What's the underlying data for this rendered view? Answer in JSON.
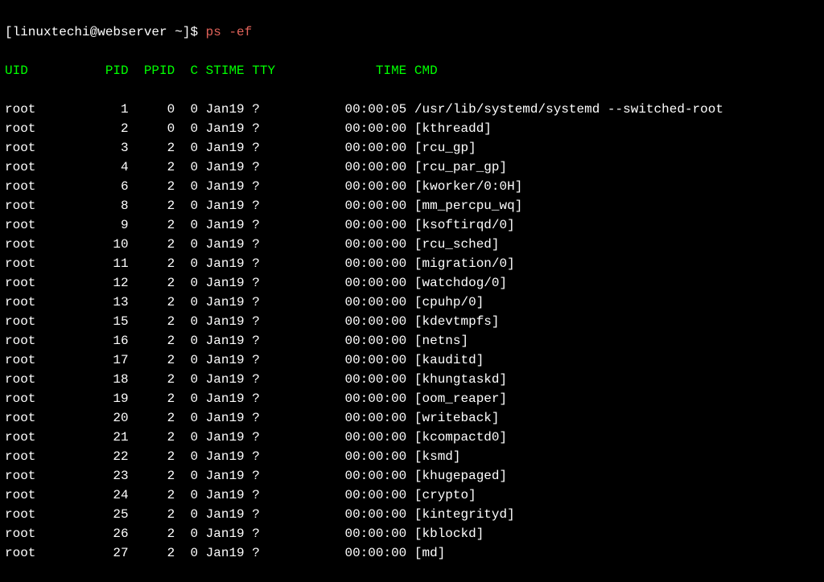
{
  "prompt": {
    "prefix": "[linuxtechi@webserver ~]$ ",
    "command": "ps",
    "args": " -ef"
  },
  "headers": {
    "uid": "UID",
    "pid": "PID",
    "ppid": "PPID",
    "c": "C",
    "stime": "STIME",
    "tty": "TTY",
    "time": "TIME",
    "cmd": "CMD"
  },
  "processes": [
    {
      "uid": "root",
      "pid": "1",
      "ppid": "0",
      "c": "0",
      "stime": "Jan19",
      "tty": "?",
      "time": "00:00:05",
      "cmd": "/usr/lib/systemd/systemd --switched-root"
    },
    {
      "uid": "root",
      "pid": "2",
      "ppid": "0",
      "c": "0",
      "stime": "Jan19",
      "tty": "?",
      "time": "00:00:00",
      "cmd": "[kthreadd]"
    },
    {
      "uid": "root",
      "pid": "3",
      "ppid": "2",
      "c": "0",
      "stime": "Jan19",
      "tty": "?",
      "time": "00:00:00",
      "cmd": "[rcu_gp]"
    },
    {
      "uid": "root",
      "pid": "4",
      "ppid": "2",
      "c": "0",
      "stime": "Jan19",
      "tty": "?",
      "time": "00:00:00",
      "cmd": "[rcu_par_gp]"
    },
    {
      "uid": "root",
      "pid": "6",
      "ppid": "2",
      "c": "0",
      "stime": "Jan19",
      "tty": "?",
      "time": "00:00:00",
      "cmd": "[kworker/0:0H]"
    },
    {
      "uid": "root",
      "pid": "8",
      "ppid": "2",
      "c": "0",
      "stime": "Jan19",
      "tty": "?",
      "time": "00:00:00",
      "cmd": "[mm_percpu_wq]"
    },
    {
      "uid": "root",
      "pid": "9",
      "ppid": "2",
      "c": "0",
      "stime": "Jan19",
      "tty": "?",
      "time": "00:00:00",
      "cmd": "[ksoftirqd/0]"
    },
    {
      "uid": "root",
      "pid": "10",
      "ppid": "2",
      "c": "0",
      "stime": "Jan19",
      "tty": "?",
      "time": "00:00:00",
      "cmd": "[rcu_sched]"
    },
    {
      "uid": "root",
      "pid": "11",
      "ppid": "2",
      "c": "0",
      "stime": "Jan19",
      "tty": "?",
      "time": "00:00:00",
      "cmd": "[migration/0]"
    },
    {
      "uid": "root",
      "pid": "12",
      "ppid": "2",
      "c": "0",
      "stime": "Jan19",
      "tty": "?",
      "time": "00:00:00",
      "cmd": "[watchdog/0]"
    },
    {
      "uid": "root",
      "pid": "13",
      "ppid": "2",
      "c": "0",
      "stime": "Jan19",
      "tty": "?",
      "time": "00:00:00",
      "cmd": "[cpuhp/0]"
    },
    {
      "uid": "root",
      "pid": "15",
      "ppid": "2",
      "c": "0",
      "stime": "Jan19",
      "tty": "?",
      "time": "00:00:00",
      "cmd": "[kdevtmpfs]"
    },
    {
      "uid": "root",
      "pid": "16",
      "ppid": "2",
      "c": "0",
      "stime": "Jan19",
      "tty": "?",
      "time": "00:00:00",
      "cmd": "[netns]"
    },
    {
      "uid": "root",
      "pid": "17",
      "ppid": "2",
      "c": "0",
      "stime": "Jan19",
      "tty": "?",
      "time": "00:00:00",
      "cmd": "[kauditd]"
    },
    {
      "uid": "root",
      "pid": "18",
      "ppid": "2",
      "c": "0",
      "stime": "Jan19",
      "tty": "?",
      "time": "00:00:00",
      "cmd": "[khungtaskd]"
    },
    {
      "uid": "root",
      "pid": "19",
      "ppid": "2",
      "c": "0",
      "stime": "Jan19",
      "tty": "?",
      "time": "00:00:00",
      "cmd": "[oom_reaper]"
    },
    {
      "uid": "root",
      "pid": "20",
      "ppid": "2",
      "c": "0",
      "stime": "Jan19",
      "tty": "?",
      "time": "00:00:00",
      "cmd": "[writeback]"
    },
    {
      "uid": "root",
      "pid": "21",
      "ppid": "2",
      "c": "0",
      "stime": "Jan19",
      "tty": "?",
      "time": "00:00:00",
      "cmd": "[kcompactd0]"
    },
    {
      "uid": "root",
      "pid": "22",
      "ppid": "2",
      "c": "0",
      "stime": "Jan19",
      "tty": "?",
      "time": "00:00:00",
      "cmd": "[ksmd]"
    },
    {
      "uid": "root",
      "pid": "23",
      "ppid": "2",
      "c": "0",
      "stime": "Jan19",
      "tty": "?",
      "time": "00:00:00",
      "cmd": "[khugepaged]"
    },
    {
      "uid": "root",
      "pid": "24",
      "ppid": "2",
      "c": "0",
      "stime": "Jan19",
      "tty": "?",
      "time": "00:00:00",
      "cmd": "[crypto]"
    },
    {
      "uid": "root",
      "pid": "25",
      "ppid": "2",
      "c": "0",
      "stime": "Jan19",
      "tty": "?",
      "time": "00:00:00",
      "cmd": "[kintegrityd]"
    },
    {
      "uid": "root",
      "pid": "26",
      "ppid": "2",
      "c": "0",
      "stime": "Jan19",
      "tty": "?",
      "time": "00:00:00",
      "cmd": "[kblockd]"
    },
    {
      "uid": "root",
      "pid": "27",
      "ppid": "2",
      "c": "0",
      "stime": "Jan19",
      "tty": "?",
      "time": "00:00:00",
      "cmd": "[md]"
    }
  ]
}
